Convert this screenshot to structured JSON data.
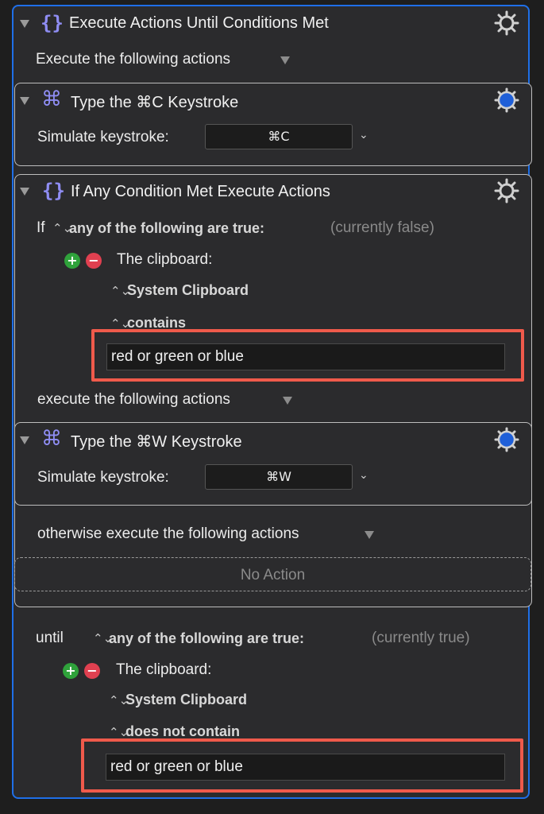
{
  "outer": {
    "title": "Execute Actions Until Conditions Met",
    "execute_label": "Execute the following actions",
    "until_label": "until",
    "until_condition": "any of the following are true:",
    "until_status": "(currently true)",
    "until_clipboard_label": "The clipboard:",
    "until_clipboard_source": "System Clipboard",
    "until_operator": "does not contain",
    "until_value": "red or green or blue"
  },
  "type_c": {
    "title": "Type the ⌘C Keystroke",
    "simulate_label": "Simulate keystroke:",
    "keystroke": "⌘C"
  },
  "if_block": {
    "title": "If Any Condition Met Execute Actions",
    "if_label": "If",
    "condition": "any of the following are true:",
    "status": "(currently false)",
    "clipboard_label": "The clipboard:",
    "clipboard_source": "System Clipboard",
    "operator": "contains",
    "value": "red or green or blue",
    "execute_label": "execute the following actions",
    "otherwise_label": "otherwise execute the following actions",
    "no_action": "No Action"
  },
  "type_w": {
    "title": "Type the ⌘W Keystroke",
    "simulate_label": "Simulate keystroke:",
    "keystroke": "⌘W"
  },
  "colors": {
    "accent_blue": "#1f6fe8",
    "highlight_red": "#ef5a4b",
    "icon_purple": "#8f8df3",
    "plus_green": "#2fa23b",
    "minus_red": "#e04050"
  }
}
